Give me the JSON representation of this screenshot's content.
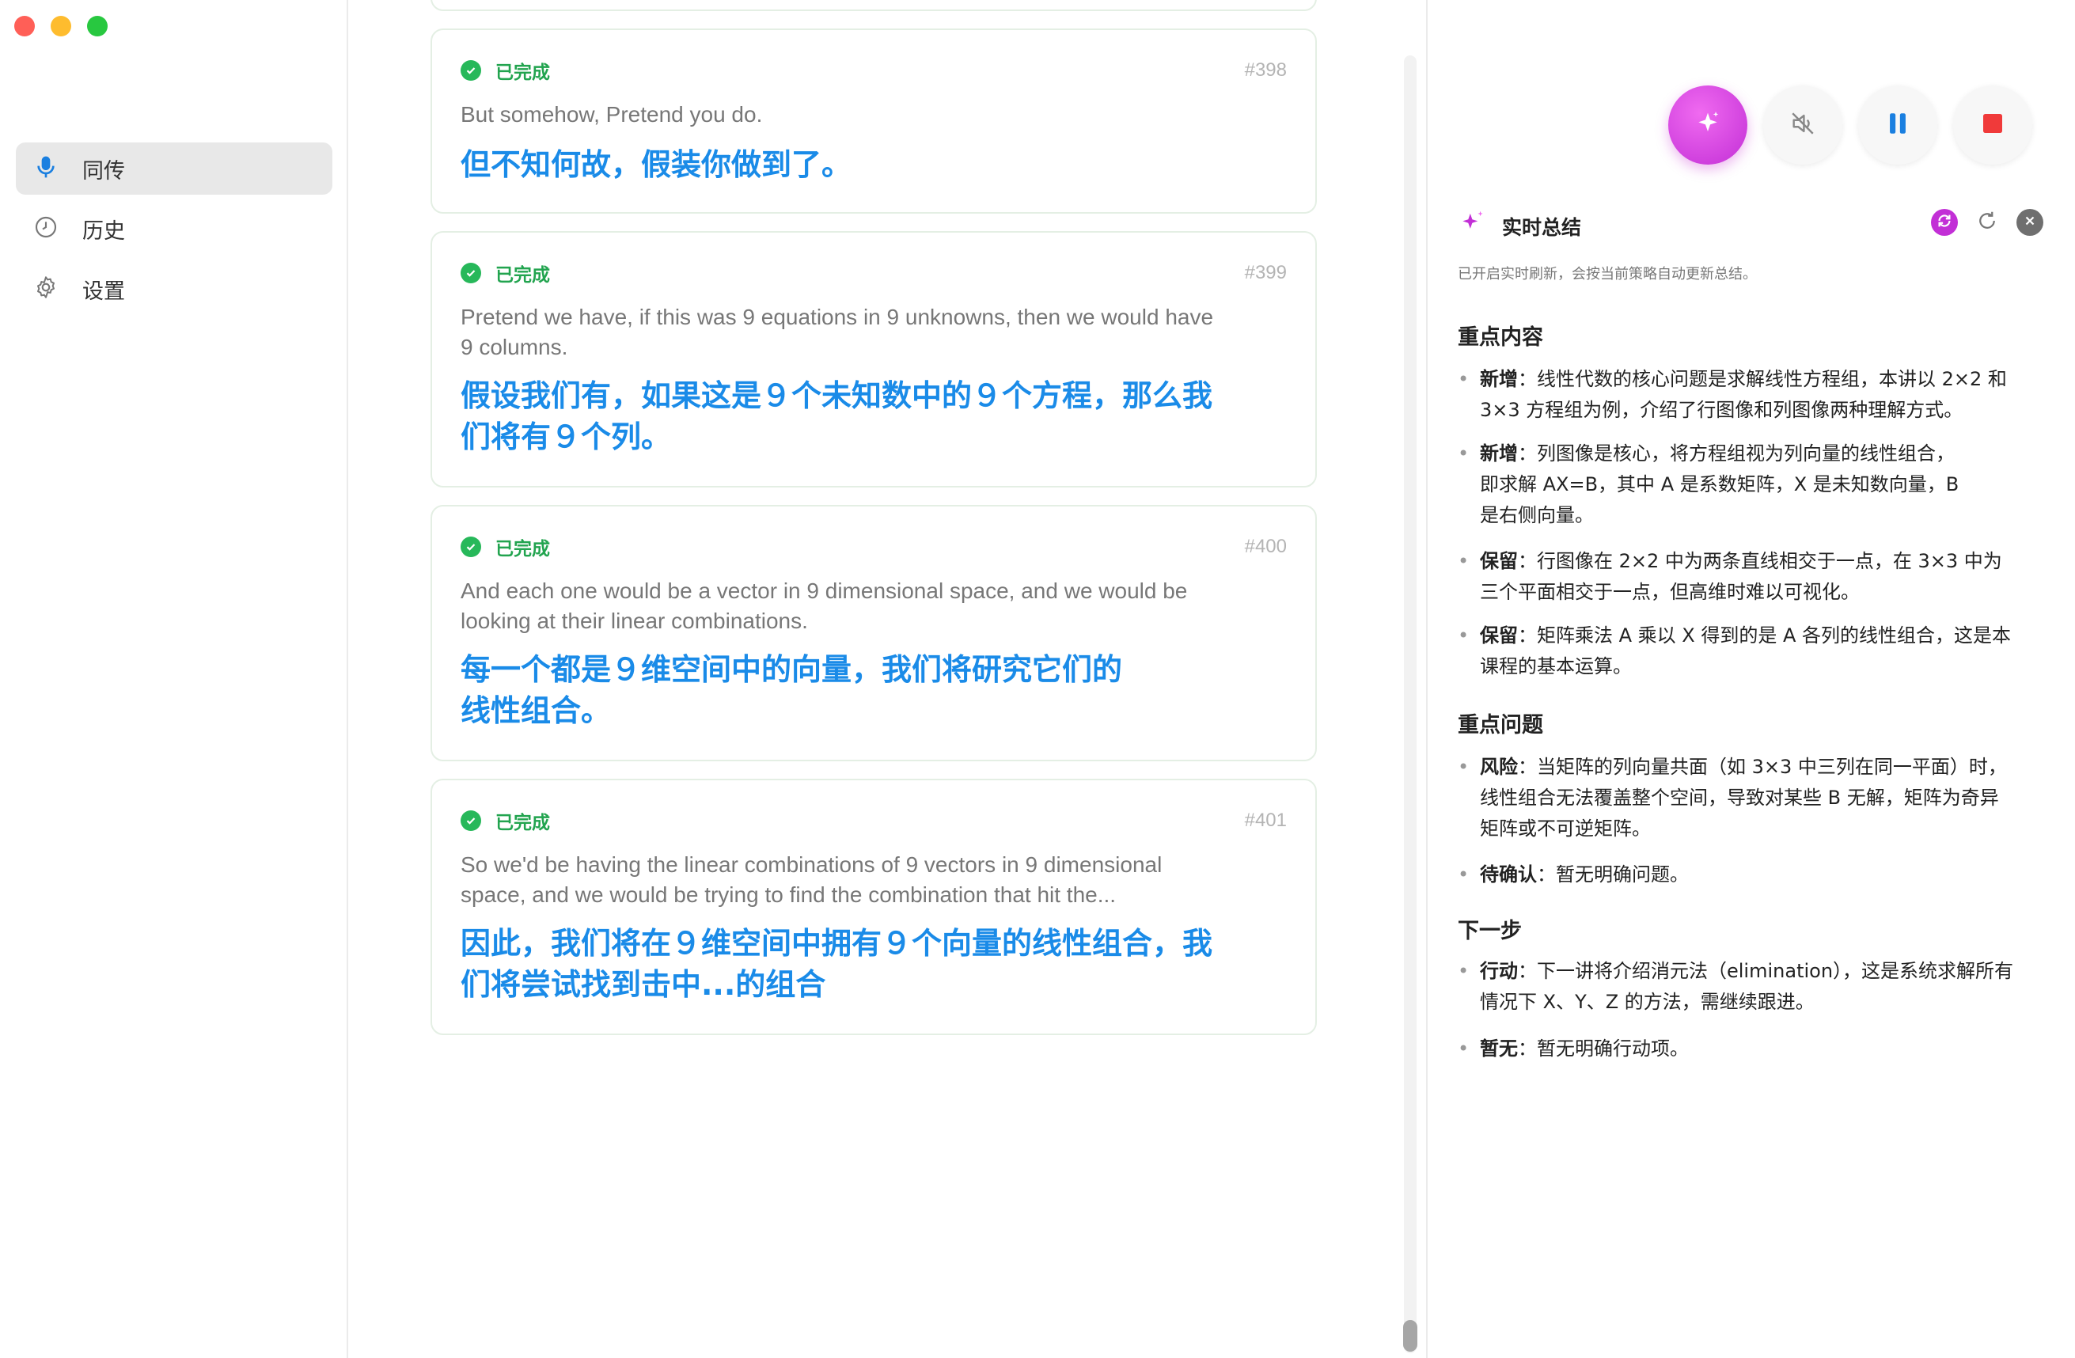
{
  "sidebar": {
    "items": [
      {
        "label": "同传",
        "icon": "microphone-icon",
        "active": true
      },
      {
        "label": "历史",
        "icon": "clock-icon",
        "active": false
      },
      {
        "label": "设置",
        "icon": "gear-icon",
        "active": false
      }
    ]
  },
  "cards": [
    {
      "status": "已完成",
      "id": "#398",
      "source": "But somehow, Pretend you do.",
      "target": [
        "但不知何故，假装你做到了。"
      ]
    },
    {
      "status": "已完成",
      "id": "#399",
      "source": [
        "Pretend we have, if this was 9 equations in 9 unknowns, then we would have",
        "9 columns."
      ],
      "target": [
        "假设我们有，如果这是９个未知数中的９个方程，那么我",
        "们将有９个列。"
      ]
    },
    {
      "status": "已完成",
      "id": "#400",
      "source": [
        "And each one would be a vector in 9 dimensional space, and we would be",
        "looking at their linear combinations."
      ],
      "target": [
        "每一个都是９维空间中的向量，我们将研究它们的",
        "线性组合。"
      ]
    },
    {
      "status": "已完成",
      "id": "#401",
      "source": [
        "So we'd be having the linear combinations of 9 vectors in 9 dimensional",
        "space, and we would be trying to find the combination that hit the..."
      ],
      "target": [
        "因此，我们将在９维空间中拥有９个向量的线性组合，我",
        "们将尝试找到击中...的组合"
      ]
    }
  ],
  "summary": {
    "title": "实时总结",
    "hint": "已开启实时刷新，会按当前策略自动更新总结。",
    "sections": [
      {
        "title": "重点内容",
        "items": [
          {
            "tag": "新增",
            "lines": [
              "：线性代数的核心问题是求解线性方程组，本讲以 2×2 和",
              "3×3 方程组为例，介绍了行图像和列图像两种理解方式。"
            ]
          },
          {
            "tag": "新增",
            "lines": [
              "：列图像是核心，将方程组视为列向量的线性组合，",
              "即求解 AX=B，其中 A 是系数矩阵，X 是未知数向量，B",
              "是右侧向量。"
            ]
          },
          {
            "tag": "保留",
            "lines": [
              "：行图像在 2×2 中为两条直线相交于一点，在 3×3 中为",
              "三个平面相交于一点，但高维时难以可视化。"
            ]
          },
          {
            "tag": "保留",
            "lines": [
              "：矩阵乘法 A 乘以 X 得到的是 A 各列的线性组合，这是本",
              "课程的基本运算。"
            ]
          }
        ]
      },
      {
        "title": "重点问题",
        "items": [
          {
            "tag": "风险",
            "lines": [
              "：当矩阵的列向量共面（如 3×3 中三列在同一平面）时，",
              "线性组合无法覆盖整个空间，导致对某些 B 无解，矩阵为奇异",
              "矩阵或不可逆矩阵。"
            ]
          },
          {
            "tag": "待确认",
            "lines": [
              "：暂无明确问题。"
            ]
          }
        ]
      },
      {
        "title": "下一步",
        "items": [
          {
            "tag": "行动",
            "lines": [
              "：下一讲将介绍消元法（elimination），这是系统求解所有",
              "情况下 X、Y、Z 的方法，需继续跟进。"
            ]
          },
          {
            "tag": "暂无",
            "lines": [
              "：暂无明确行动项。"
            ]
          }
        ]
      }
    ]
  },
  "colors": {
    "accent": "#1a8be8",
    "success": "#27b85a",
    "stop": "#f03a3a",
    "ai": "#c22fd6"
  }
}
